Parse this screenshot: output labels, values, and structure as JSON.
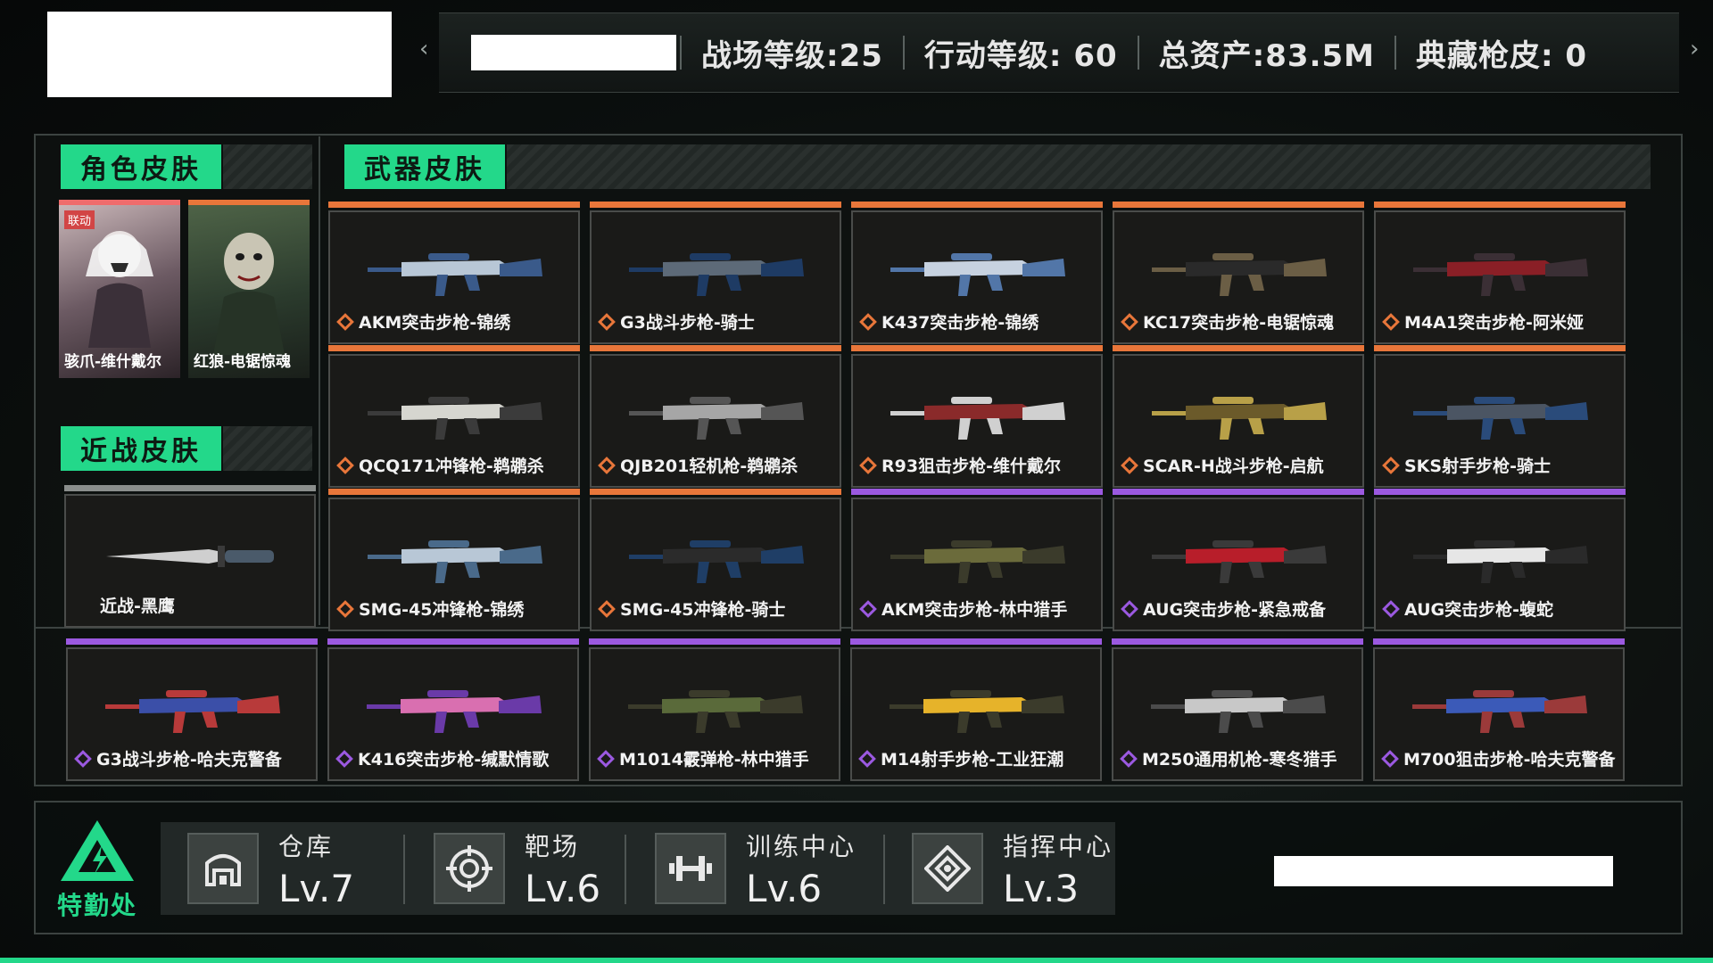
{
  "header": {
    "stats": [
      {
        "label": "战场等级:25"
      },
      {
        "label": "行动等级: 60"
      },
      {
        "label": "总资产:83.5M"
      },
      {
        "label": "典藏枪皮: 0"
      }
    ]
  },
  "sections": {
    "character": "角色皮肤",
    "melee": "近战皮肤",
    "weapon": "武器皮肤"
  },
  "character_skins": [
    {
      "name": "骇爪-维什戴尔",
      "badge": "联动"
    },
    {
      "name": "红狼-电锯惊魂"
    }
  ],
  "melee_skins": [
    {
      "name": "近战-黑鹰"
    }
  ],
  "weapon_skins": [
    {
      "name": "AKM突击步枪-锦绣",
      "rarity": "orange"
    },
    {
      "name": "G3战斗步枪-骑士",
      "rarity": "orange"
    },
    {
      "name": "K437突击步枪-锦绣",
      "rarity": "orange"
    },
    {
      "name": "KC17突击步枪-电锯惊魂",
      "rarity": "orange"
    },
    {
      "name": "M4A1突击步枪-阿米娅",
      "rarity": "orange"
    },
    {
      "name": "QCQ171冲锋枪-鹈鹕杀",
      "rarity": "orange"
    },
    {
      "name": "QJB201轻机枪-鹈鹕杀",
      "rarity": "orange"
    },
    {
      "name": "R93狙击步枪-维什戴尔",
      "rarity": "orange"
    },
    {
      "name": "SCAR-H战斗步枪-启航",
      "rarity": "orange"
    },
    {
      "name": "SKS射手步枪-骑士",
      "rarity": "orange"
    },
    {
      "name": "SMG-45冲锋枪-锦绣",
      "rarity": "orange"
    },
    {
      "name": "SMG-45冲锋枪-骑士",
      "rarity": "orange"
    },
    {
      "name": "AKM突击步枪-林中猎手",
      "rarity": "purple"
    },
    {
      "name": "AUG突击步枪-紧急戒备",
      "rarity": "purple"
    },
    {
      "name": "AUG突击步枪-蝮蛇",
      "rarity": "purple"
    },
    {
      "name": "G3战斗步枪-哈夫克警备",
      "rarity": "purple"
    },
    {
      "name": "K416突击步枪-缄默情歌",
      "rarity": "purple"
    },
    {
      "name": "M1014霰弹枪-林中猎手",
      "rarity": "purple"
    },
    {
      "name": "M14射手步枪-工业狂潮",
      "rarity": "purple"
    },
    {
      "name": "M250通用机枪-寒冬猎手",
      "rarity": "purple"
    },
    {
      "name": "M700狙击步枪-哈夫克警备",
      "rarity": "purple"
    }
  ],
  "facilities": [
    {
      "name": "仓库",
      "level": "Lv.7",
      "icon": "warehouse-icon"
    },
    {
      "name": "靶场",
      "level": "Lv.6",
      "icon": "target-icon"
    },
    {
      "name": "训练中心",
      "level": "Lv.6",
      "icon": "dumbbell-icon"
    },
    {
      "name": "指挥中心",
      "level": "Lv.3",
      "icon": "command-icon"
    }
  ],
  "logo_text": "特勤处",
  "colors": {
    "accent": "#23d88a",
    "orange": "#e8763a",
    "purple": "#9b59e0",
    "red": "#ef6c6c"
  }
}
